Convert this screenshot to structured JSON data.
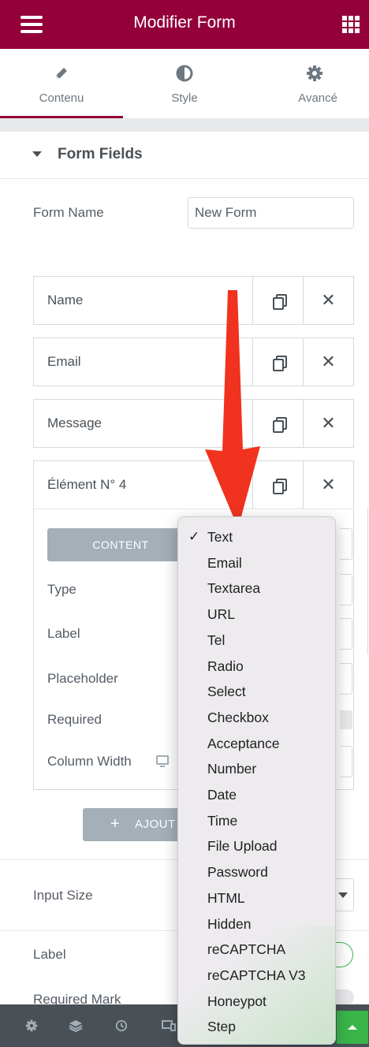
{
  "header": {
    "title": "Modifier Form"
  },
  "tabs": [
    {
      "label": "Contenu",
      "icon": "pencil-icon",
      "active": true
    },
    {
      "label": "Style",
      "icon": "half-circle-icon",
      "active": false
    },
    {
      "label": "Avancé",
      "icon": "gear-icon",
      "active": false
    }
  ],
  "section": {
    "title": "Form Fields"
  },
  "form_name": {
    "label": "Form Name",
    "value": "New Form"
  },
  "fields": [
    {
      "name": "Name"
    },
    {
      "name": "Email"
    },
    {
      "name": "Message"
    },
    {
      "name": "Élément N° 4"
    }
  ],
  "expanded_field": {
    "content_tab": "CONTENT",
    "labels": [
      "Type",
      "Label",
      "Placeholder",
      "Required",
      "Column Width"
    ]
  },
  "add_button": {
    "plus": "+",
    "label": "AJOUT"
  },
  "settings": {
    "input_size_label": "Input Size",
    "label_label": "Label",
    "required_mark_label": "Required Mark"
  },
  "dropdown": {
    "selected": "Text",
    "options": [
      "Text",
      "Email",
      "Textarea",
      "URL",
      "Tel",
      "Radio",
      "Select",
      "Checkbox",
      "Acceptance",
      "Number",
      "Date",
      "Time",
      "File Upload",
      "Password",
      "HTML",
      "Hidden",
      "reCAPTCHA",
      "reCAPTCHA V3",
      "Honeypot",
      "Step"
    ]
  },
  "colors": {
    "brand": "#93003a",
    "arrow": "#f0321e",
    "publish": "#39b54a",
    "bottom_bar": "#495157"
  },
  "bottom_bar_icons": [
    "settings-icon",
    "layers-icon",
    "history-icon",
    "responsive-icon"
  ]
}
